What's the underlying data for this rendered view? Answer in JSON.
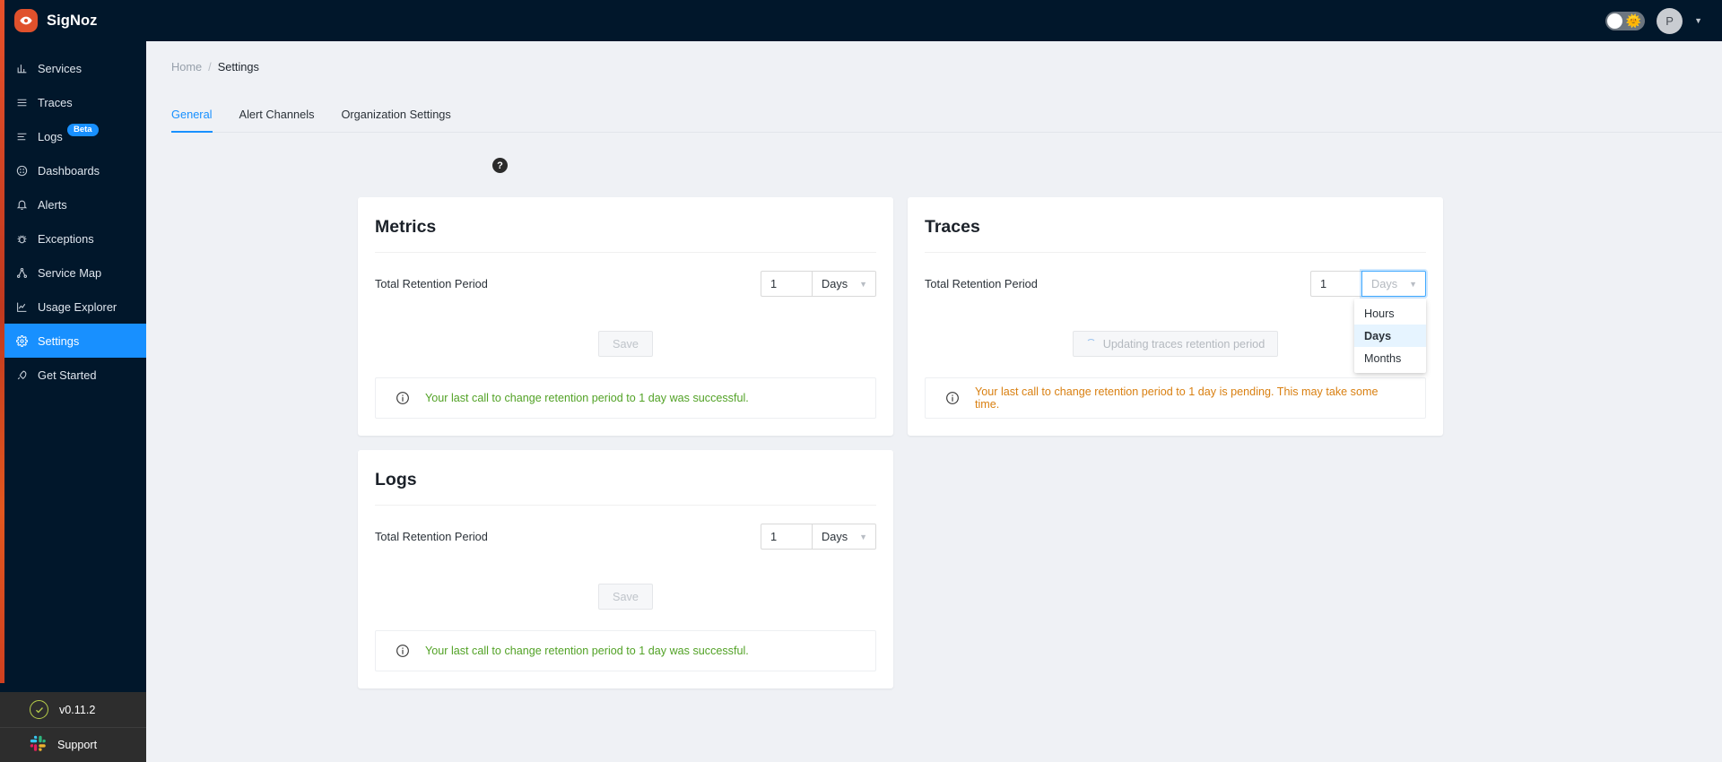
{
  "brand": {
    "name": "SigNoz",
    "logo_icon": "eye-icon"
  },
  "sidebar": {
    "items": [
      {
        "label": "Services",
        "icon": "bar-chart-icon",
        "active": false,
        "badge": null
      },
      {
        "label": "Traces",
        "icon": "menu-lines-icon",
        "active": false,
        "badge": null
      },
      {
        "label": "Logs",
        "icon": "log-lines-icon",
        "active": false,
        "badge": "Beta"
      },
      {
        "label": "Dashboards",
        "icon": "dashboard-grid-icon",
        "active": false,
        "badge": null
      },
      {
        "label": "Alerts",
        "icon": "bell-icon",
        "active": false,
        "badge": null
      },
      {
        "label": "Exceptions",
        "icon": "bug-icon",
        "active": false,
        "badge": null
      },
      {
        "label": "Service Map",
        "icon": "node-graph-icon",
        "active": false,
        "badge": null
      },
      {
        "label": "Usage Explorer",
        "icon": "line-chart-icon",
        "active": false,
        "badge": null
      },
      {
        "label": "Settings",
        "icon": "gear-icon",
        "active": true,
        "badge": null
      },
      {
        "label": "Get Started",
        "icon": "rocket-icon",
        "active": false,
        "badge": null
      }
    ],
    "footer": {
      "version": "v0.11.2",
      "version_icon": "check-circle-icon",
      "support": "Support",
      "support_icon": "slack-icon"
    }
  },
  "topbar": {
    "theme_toggle_icon": "sun-icon",
    "avatar_initial": "P",
    "caret_icon": "chevron-down-icon"
  },
  "breadcrumb": {
    "home": "Home",
    "separator": "/",
    "current": "Settings"
  },
  "tabs": [
    {
      "label": "General",
      "active": true
    },
    {
      "label": "Alert Channels",
      "active": false
    },
    {
      "label": "Organization Settings",
      "active": false
    }
  ],
  "help": {
    "icon": "question-mark-icon",
    "glyph": "?"
  },
  "common": {
    "retention_label": "Total Retention Period",
    "save_label": "Save",
    "info_icon": "info-circle-icon",
    "select_caret_icon": "chevron-down-icon"
  },
  "dropdown": {
    "options": [
      "Hours",
      "Days",
      "Months"
    ],
    "selected": "Days"
  },
  "cards": [
    {
      "title": "Metrics",
      "retention_label": "Total Retention Period",
      "value": "1",
      "unit": "Days",
      "button_label": "Save",
      "button_state": "disabled",
      "alert_text": "Your last call to change retention period to 1 day was successful.",
      "alert_type": "success",
      "select_open": false,
      "select_focused": false
    },
    {
      "title": "Traces",
      "retention_label": "Total Retention Period",
      "value": "1",
      "unit": "Days",
      "button_label": "Updating traces retention period",
      "button_state": "loading",
      "alert_text": "Your last call to change retention period to 1 day is pending. This may take some time.",
      "alert_type": "pending",
      "select_open": true,
      "select_focused": true
    },
    {
      "title": "Logs",
      "retention_label": "Total Retention Period",
      "value": "1",
      "unit": "Days",
      "button_label": "Save",
      "button_state": "disabled",
      "alert_text": "Your last call to change retention period to 1 day was successful.",
      "alert_type": "success",
      "select_open": false,
      "select_focused": false
    }
  ],
  "colors": {
    "sidebar_bg": "#01172b",
    "accent_blue": "#1890ff",
    "brand_orange": "#e0512c",
    "content_bg": "#eff1f5",
    "success_green": "#52a226",
    "pending_orange": "#d98012",
    "dropdown_selected_bg": "#e6f4ff"
  }
}
